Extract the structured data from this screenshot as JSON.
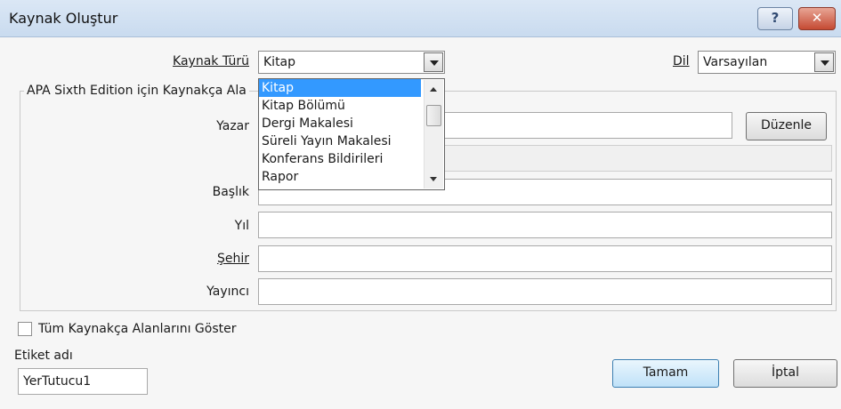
{
  "window": {
    "title": "Kaynak Oluştur"
  },
  "titlebar": {
    "help_glyph": "?",
    "close_glyph": "✕"
  },
  "source_type": {
    "label": "Kaynak Türü",
    "value": "Kitap"
  },
  "language": {
    "label": "Dil",
    "value": "Varsayılan"
  },
  "group": {
    "caption": "APA Sixth Edition için Kaynakça Ala"
  },
  "dropdown": {
    "items": [
      "Kitap",
      "Kitap Bölümü",
      "Dergi Makalesi",
      "Süreli Yayın Makalesi",
      "Konferans Bildirileri",
      "Rapor"
    ],
    "selected": "Kitap"
  },
  "fields": {
    "author_label": "Yazar",
    "edit_button": "Düzenle",
    "title_label": "Başlık",
    "year_label": "Yıl",
    "city_label": "Şehir",
    "publisher_label": "Yayıncı"
  },
  "show_all": {
    "label": "Tüm Kaynakça Alanlarını Göster",
    "checked": false
  },
  "tag": {
    "label": "Etiket adı",
    "value": "YerTutucu1"
  },
  "buttons": {
    "ok": "Tamam",
    "cancel": "İptal"
  }
}
